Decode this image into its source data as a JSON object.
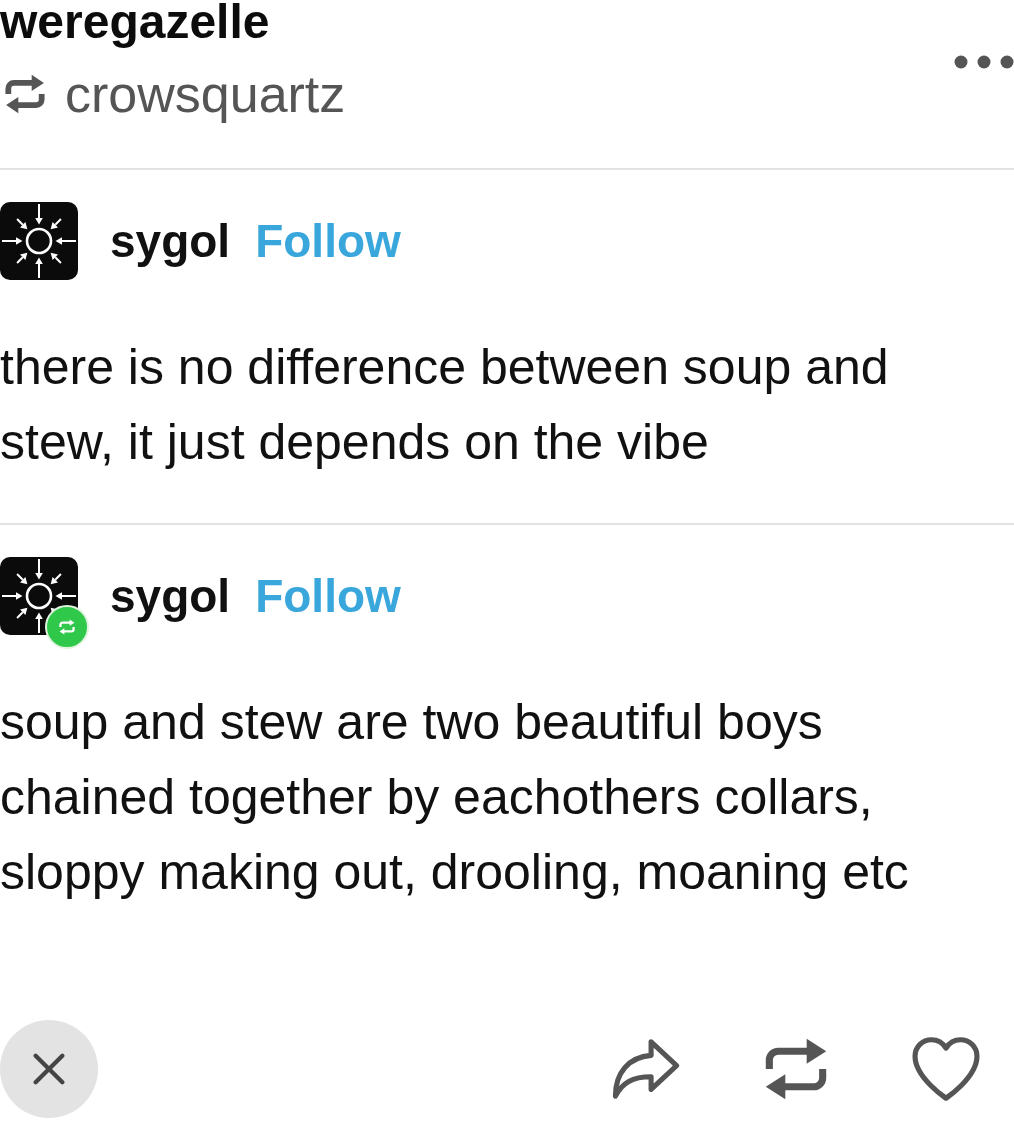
{
  "header": {
    "blog_name": "weregazelle",
    "reblogged_from": "crowsquartz"
  },
  "posts": [
    {
      "author": "sygol",
      "follow_label": "Follow",
      "reblog_badge": false,
      "text": "there is no difference between soup and stew, it just depends on the vibe"
    },
    {
      "author": "sygol",
      "follow_label": "Follow",
      "reblog_badge": true,
      "text": "soup and stew are two beautiful boys chained together by eachothers collars, sloppy making out, drooling, moaning etc"
    }
  ]
}
